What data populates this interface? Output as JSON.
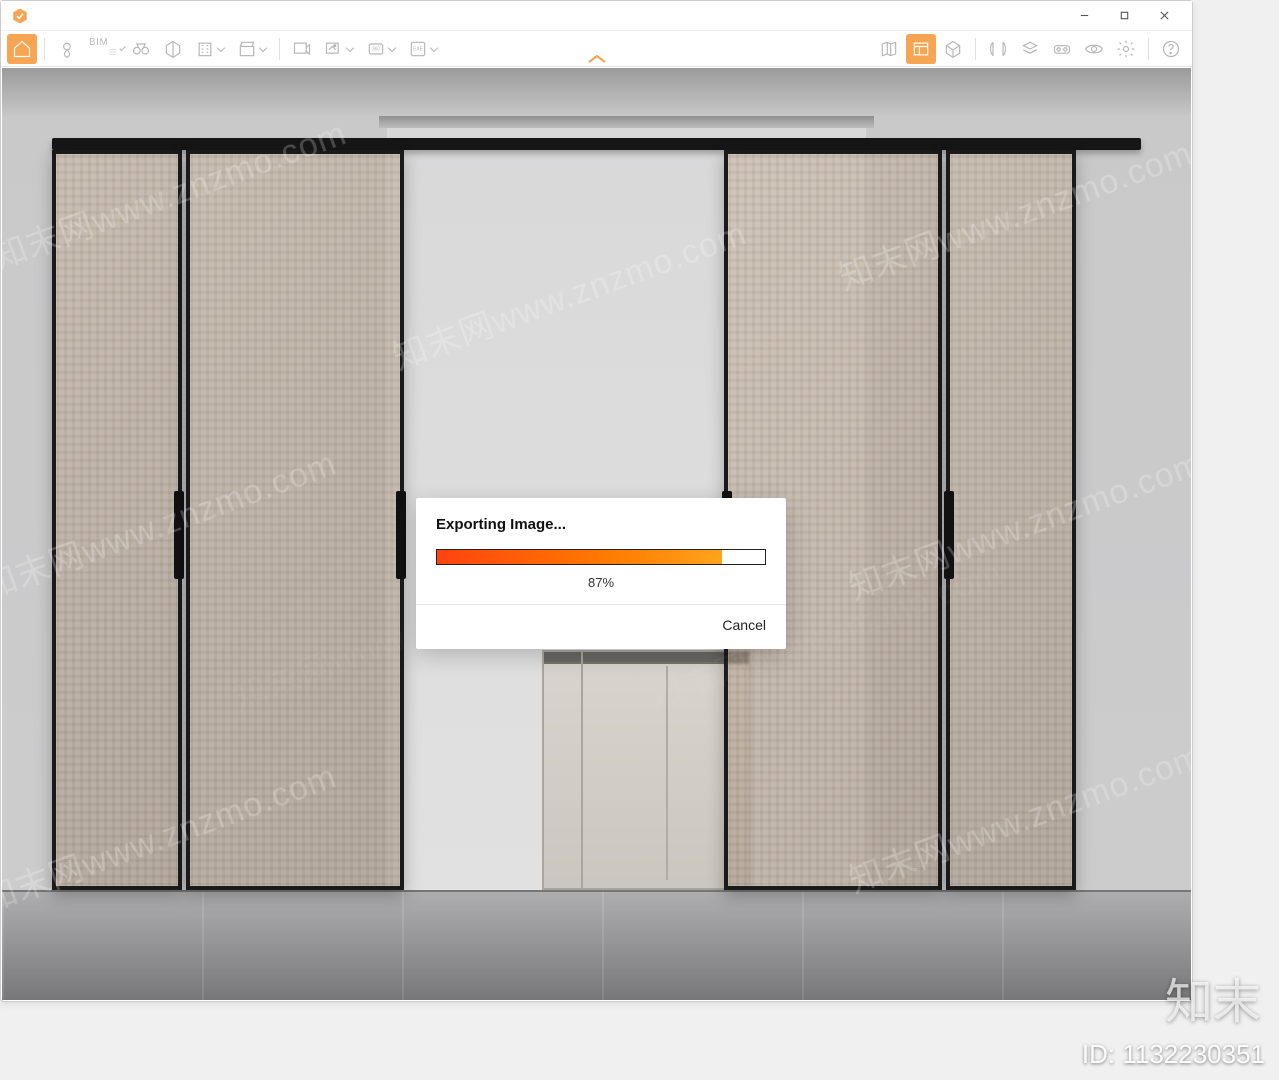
{
  "window_controls": {
    "min": "–",
    "max": "▢",
    "close": "✕"
  },
  "toolbar": {
    "bim_label": "BIM"
  },
  "dialog": {
    "title": "Exporting Image...",
    "percent_label": "87%",
    "percent_value": 87,
    "cancel_label": "Cancel"
  },
  "watermark": {
    "text": "知末网www.znzmo.com",
    "brand": "知末",
    "id_prefix": "ID: ",
    "id_value": "1132230351"
  }
}
